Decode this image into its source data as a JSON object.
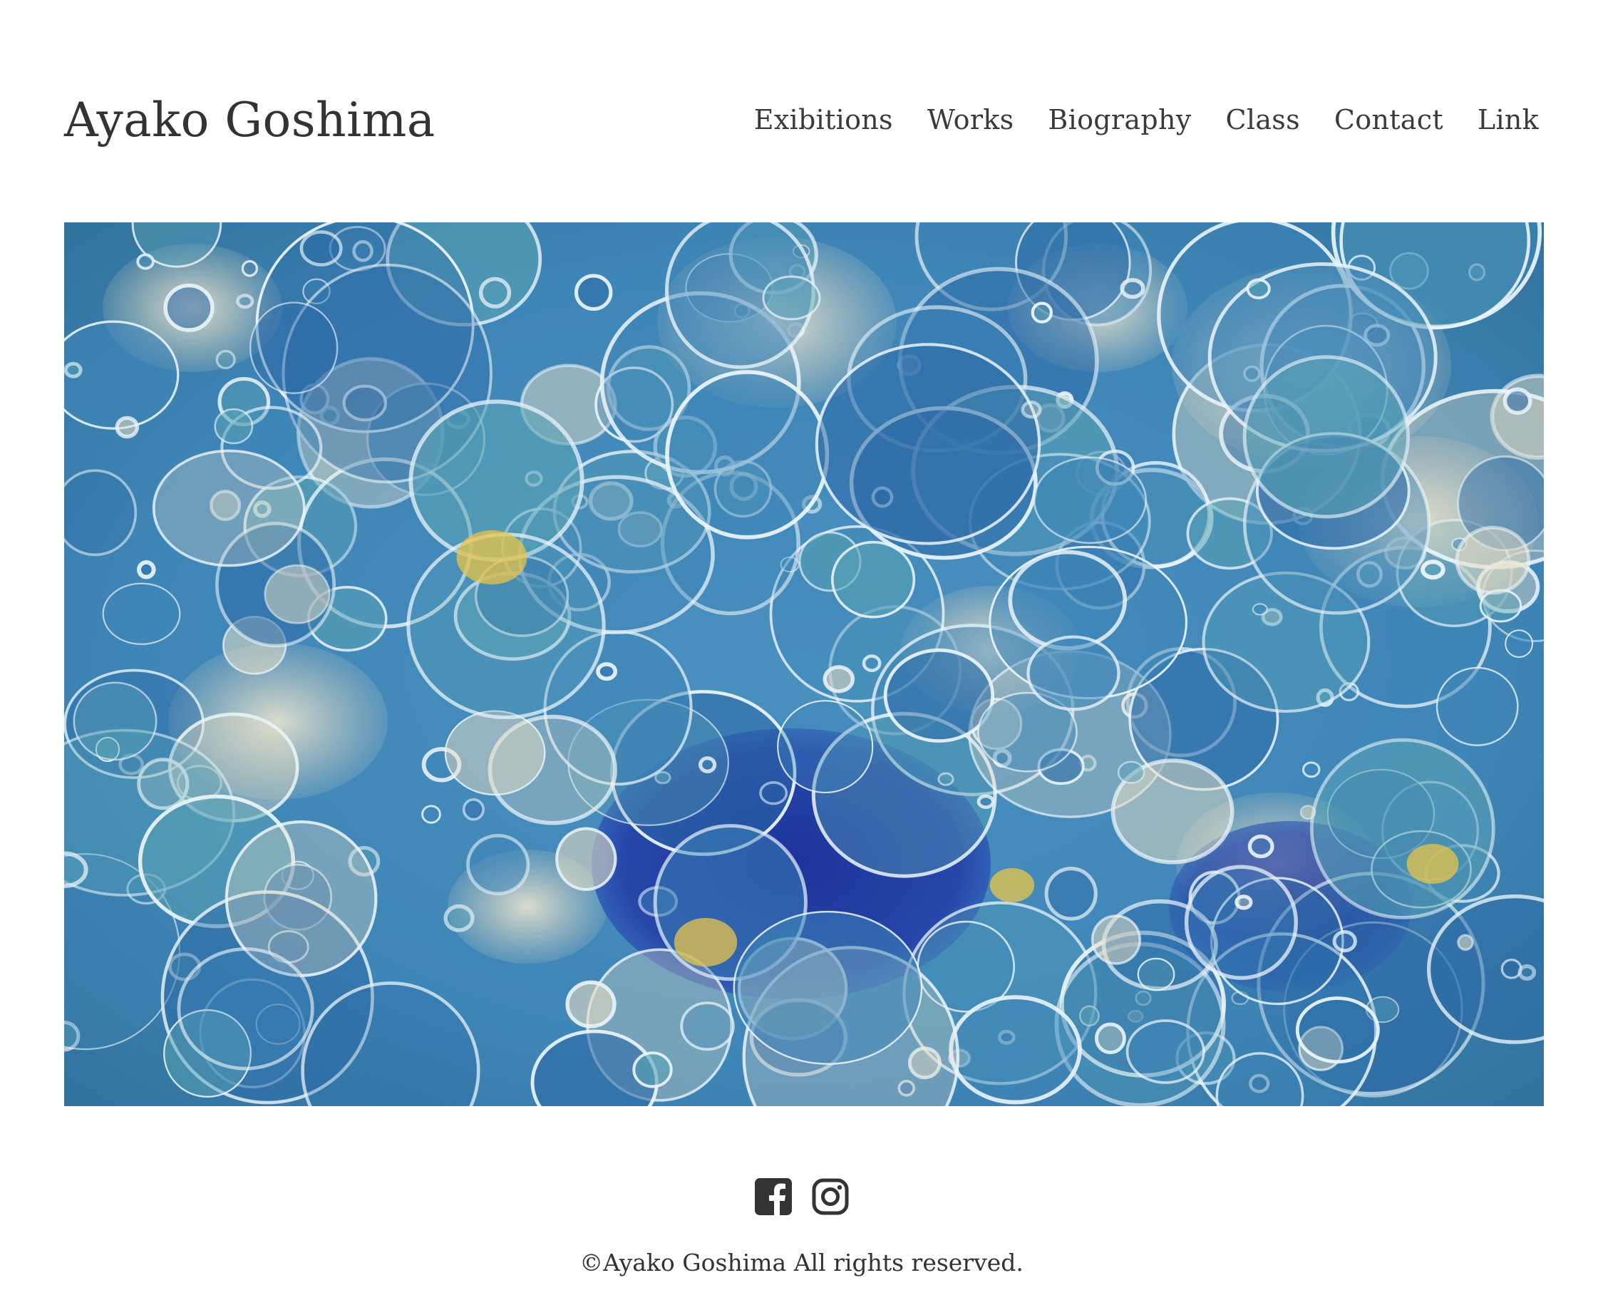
{
  "header": {
    "site_title": "Ayako Goshima",
    "nav": [
      {
        "label": "Exibitions"
      },
      {
        "label": "Works"
      },
      {
        "label": "Biography"
      },
      {
        "label": "Class"
      },
      {
        "label": "Contact"
      },
      {
        "label": "Link"
      }
    ]
  },
  "hero": {
    "image_icon": "painting-image",
    "palette": {
      "deep_blue": "#1f3fa8",
      "blue": "#3f86b8",
      "teal": "#5aa3b5",
      "light": "#e8dcc0",
      "yellow": "#e8c44a"
    }
  },
  "footer": {
    "social": [
      {
        "icon": "facebook-icon"
      },
      {
        "icon": "instagram-icon"
      }
    ],
    "copyright": "©Ayako Goshima All rights reserved.",
    "icon_color": "#333333"
  }
}
